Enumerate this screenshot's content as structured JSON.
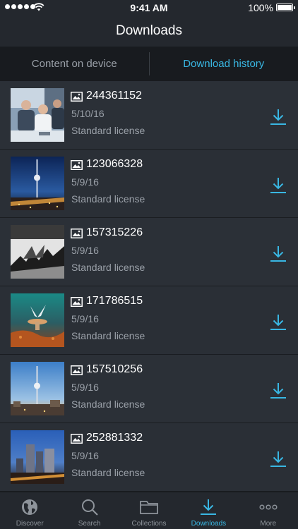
{
  "status_bar": {
    "time": "9:41 AM",
    "battery": "100%",
    "icons": [
      "signal-dots",
      "wifi-icon",
      "battery-icon"
    ]
  },
  "nav": {
    "title": "Downloads"
  },
  "segments": [
    {
      "label": "Content on device",
      "active": false
    },
    {
      "label": "Download history",
      "active": true
    }
  ],
  "accent_color": "#39b7e3",
  "downloads": [
    {
      "id": "244361152",
      "date": "5/10/16",
      "license": "Standard license",
      "thumbnail": "business-meeting"
    },
    {
      "id": "123066328",
      "date": "5/9/16",
      "license": "Standard license",
      "thumbnail": "berlin-tv-tower-night"
    },
    {
      "id": "157315226",
      "date": "5/9/16",
      "license": "Standard license",
      "thumbnail": "abstract-shark-bw"
    },
    {
      "id": "171786515",
      "date": "5/9/16",
      "license": "Standard license",
      "thumbnail": "butterfly-mushroom"
    },
    {
      "id": "157510256",
      "date": "5/9/16",
      "license": "Standard license",
      "thumbnail": "berlin-tv-tower-dusk"
    },
    {
      "id": "252881332",
      "date": "5/9/16",
      "license": "Standard license",
      "thumbnail": "city-skyline-night"
    }
  ],
  "tabs": [
    {
      "label": "Discover",
      "icon": "globe-icon",
      "active": false
    },
    {
      "label": "Search",
      "icon": "search-icon",
      "active": false
    },
    {
      "label": "Collections",
      "icon": "folder-icon",
      "active": false
    },
    {
      "label": "Downloads",
      "icon": "download-icon",
      "active": true
    },
    {
      "label": "More",
      "icon": "more-icon",
      "active": false
    }
  ]
}
